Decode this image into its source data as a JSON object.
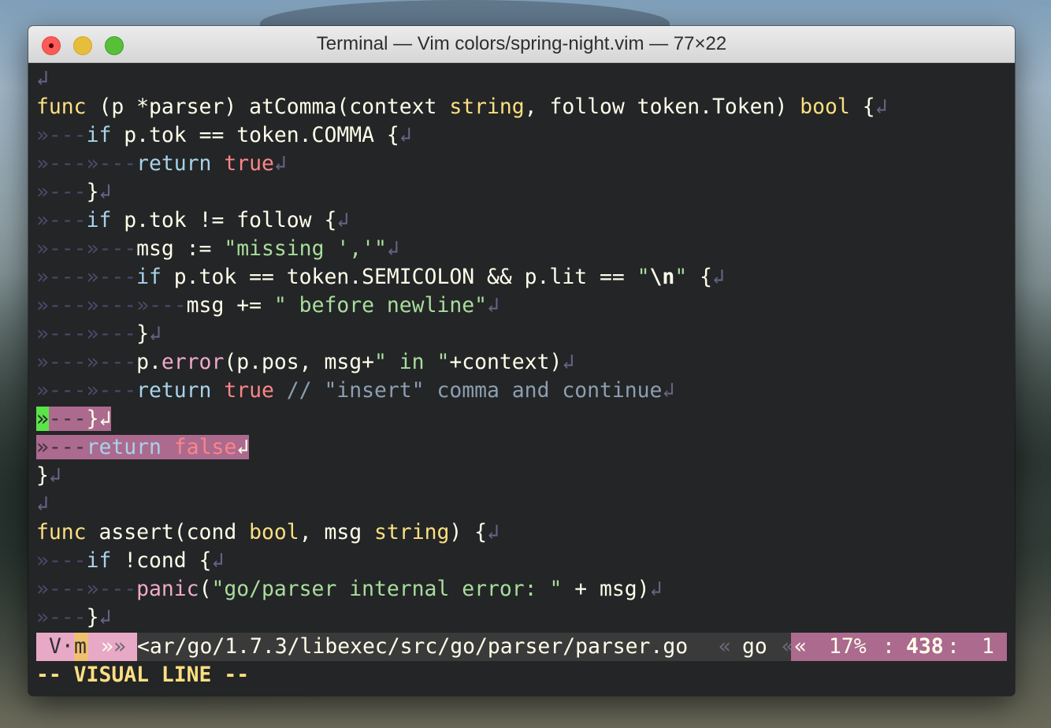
{
  "window": {
    "title": "Terminal — Vim colors/spring-night.vim — 77×22"
  },
  "editor": {
    "lines": [
      [
        {
          "t": "↲",
          "c": "nl"
        }
      ],
      [
        {
          "t": "func",
          "c": "kw"
        },
        {
          "t": " (p *parser) atComma(context ",
          "c": ""
        },
        {
          "t": "string",
          "c": "ty"
        },
        {
          "t": ", follow token.Token) ",
          "c": ""
        },
        {
          "t": "bool",
          "c": "ty"
        },
        {
          "t": " {",
          "c": ""
        },
        {
          "t": "↲",
          "c": "nl"
        }
      ],
      [
        {
          "t": "»---",
          "c": "ws"
        },
        {
          "t": "if",
          "c": "ctl"
        },
        {
          "t": " p.tok == token.COMMA {",
          "c": ""
        },
        {
          "t": "↲",
          "c": "nl"
        }
      ],
      [
        {
          "t": "»---»---",
          "c": "ws"
        },
        {
          "t": "return",
          "c": "ctl"
        },
        {
          "t": " ",
          "c": ""
        },
        {
          "t": "true",
          "c": "bo"
        },
        {
          "t": "↲",
          "c": "nl"
        }
      ],
      [
        {
          "t": "»---",
          "c": "ws"
        },
        {
          "t": "}",
          "c": ""
        },
        {
          "t": "↲",
          "c": "nl"
        }
      ],
      [
        {
          "t": "»---",
          "c": "ws"
        },
        {
          "t": "if",
          "c": "ctl"
        },
        {
          "t": " p.tok != follow {",
          "c": ""
        },
        {
          "t": "↲",
          "c": "nl"
        }
      ],
      [
        {
          "t": "»---»---",
          "c": "ws"
        },
        {
          "t": "msg := ",
          "c": ""
        },
        {
          "t": "\"missing ','\"",
          "c": "st"
        },
        {
          "t": "↲",
          "c": "nl"
        }
      ],
      [
        {
          "t": "»---»---",
          "c": "ws"
        },
        {
          "t": "if",
          "c": "ctl"
        },
        {
          "t": " p.tok == token.SEMICOLON && p.lit == ",
          "c": ""
        },
        {
          "t": "\"",
          "c": "st"
        },
        {
          "t": "\\n",
          "c": "ds"
        },
        {
          "t": "\"",
          "c": "st"
        },
        {
          "t": " {",
          "c": ""
        },
        {
          "t": "↲",
          "c": "nl"
        }
      ],
      [
        {
          "t": "»---»---»---",
          "c": "ws"
        },
        {
          "t": "msg += ",
          "c": ""
        },
        {
          "t": "\" before newline\"",
          "c": "st"
        },
        {
          "t": "↲",
          "c": "nl"
        }
      ],
      [
        {
          "t": "»---»---",
          "c": "ws"
        },
        {
          "t": "}",
          "c": ""
        },
        {
          "t": "↲",
          "c": "nl"
        }
      ],
      [
        {
          "t": "»---»---",
          "c": "ws"
        },
        {
          "t": "p.",
          "c": ""
        },
        {
          "t": "error",
          "c": "fn"
        },
        {
          "t": "(p.pos, msg+",
          "c": ""
        },
        {
          "t": "\" in \"",
          "c": "st"
        },
        {
          "t": "+context)",
          "c": ""
        },
        {
          "t": "↲",
          "c": "nl"
        }
      ],
      [
        {
          "t": "»---»---",
          "c": "ws"
        },
        {
          "t": "return",
          "c": "ctl"
        },
        {
          "t": " ",
          "c": ""
        },
        {
          "t": "true",
          "c": "bo"
        },
        {
          "t": " // \"insert\" comma and continue",
          "c": "cm"
        },
        {
          "t": "↲",
          "c": "nl"
        }
      ],
      [
        {
          "t": "»",
          "c": "cursor"
        },
        {
          "t": "---",
          "c": "ws"
        },
        {
          "t": "}",
          "c": ""
        },
        {
          "t": "↲",
          "c": "nl"
        }
      ],
      [
        {
          "t": "»---",
          "c": "ws"
        },
        {
          "t": "return",
          "c": "ctl"
        },
        {
          "t": " ",
          "c": ""
        },
        {
          "t": "false",
          "c": "bo"
        },
        {
          "t": "↲",
          "c": "nl"
        }
      ],
      [
        {
          "t": "}",
          "c": ""
        },
        {
          "t": "↲",
          "c": "nl"
        }
      ],
      [
        {
          "t": "↲",
          "c": "nl"
        }
      ],
      [
        {
          "t": "func",
          "c": "kw"
        },
        {
          "t": " assert(cond ",
          "c": ""
        },
        {
          "t": "bool",
          "c": "ty"
        },
        {
          "t": ", msg ",
          "c": ""
        },
        {
          "t": "string",
          "c": "ty"
        },
        {
          "t": ") {",
          "c": ""
        },
        {
          "t": "↲",
          "c": "nl"
        }
      ],
      [
        {
          "t": "»---",
          "c": "ws"
        },
        {
          "t": "if",
          "c": "ctl"
        },
        {
          "t": " !cond {",
          "c": ""
        },
        {
          "t": "↲",
          "c": "nl"
        }
      ],
      [
        {
          "t": "»---»---",
          "c": "ws"
        },
        {
          "t": "panic",
          "c": "fn"
        },
        {
          "t": "(",
          "c": ""
        },
        {
          "t": "\"go/parser internal error: \"",
          "c": "st"
        },
        {
          "t": " + msg)",
          "c": ""
        },
        {
          "t": "↲",
          "c": "nl"
        }
      ],
      [
        {
          "t": "»---",
          "c": "ws"
        },
        {
          "t": "}",
          "c": ""
        },
        {
          "t": "↲",
          "c": "nl"
        }
      ]
    ],
    "selected_lines": [
      12,
      13
    ]
  },
  "statusline": {
    "mode": "V·",
    "mode_char": "m",
    "sep_left": "»",
    "sep_left2": "»",
    "path": "<ar/go/1.7.3/libexec/src/go/parser/parser.go",
    "sep_mid": "«",
    "filetype": "go",
    "sep_right": "«",
    "sep_right2": "«",
    "percent": "17%",
    "colon1": ":",
    "line": "438",
    "colon2": ":",
    "column": "1"
  },
  "cmdline": {
    "text": "-- VISUAL LINE --"
  }
}
